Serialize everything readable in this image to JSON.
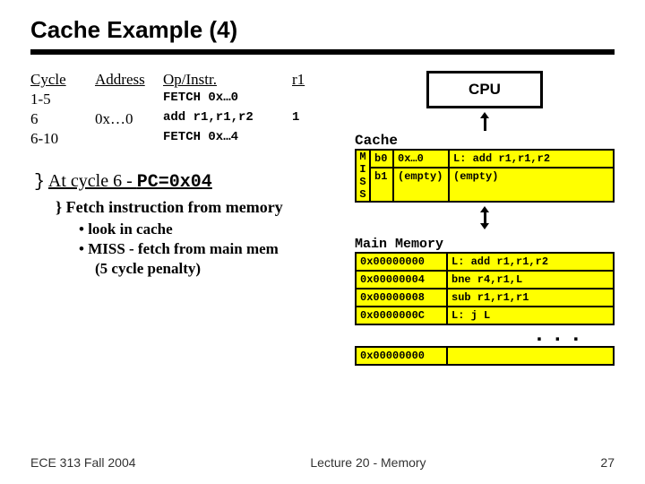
{
  "title": "Cache Example (4)",
  "trace": {
    "headers": [
      "Cycle",
      "Address",
      "Op/Instr.",
      "r1"
    ],
    "rows": [
      {
        "cycle": "1-5",
        "addr": "",
        "op": "FETCH 0x…0",
        "r1": ""
      },
      {
        "cycle": "6",
        "addr": "0x…0",
        "op": "add r1,r1,r2",
        "r1": "1"
      },
      {
        "cycle": "6-10",
        "addr": "",
        "op": "FETCH 0x…4",
        "r1": ""
      }
    ]
  },
  "bullets": {
    "brace": "}",
    "main_pre": "At cycle 6 - ",
    "main_pc": "PC=0x04",
    "sub1": "Fetch instruction from memory",
    "sub2a": "• look in cache",
    "sub2b": "• MISS - fetch from main mem",
    "sub2c": "(5 cycle penalty)"
  },
  "cpu_label": "CPU",
  "cache": {
    "label": "Cache",
    "miss": [
      "M",
      "I",
      "S",
      "S"
    ],
    "rows": [
      {
        "blk": "b0",
        "addr": "0x…0",
        "instr": "L: add r1,r1,r2"
      },
      {
        "blk": "b1",
        "addr": "(empty)",
        "instr": "(empty)"
      }
    ]
  },
  "main_mem": {
    "label": "Main Memory",
    "rows": [
      {
        "addr": "0x00000000",
        "instr": "L: add r1,r1,r2"
      },
      {
        "addr": "0x00000004",
        "instr": "bne r4,r1,L"
      },
      {
        "addr": "0x00000008",
        "instr": "sub r1,r1,r1"
      },
      {
        "addr": "0x0000000C",
        "instr": "L: j L"
      }
    ],
    "dots": "...",
    "last": {
      "addr": "0x00000000",
      "instr": ""
    }
  },
  "footer": {
    "left": "ECE 313 Fall 2004",
    "center": "Lecture 20 - Memory",
    "right": "27"
  }
}
